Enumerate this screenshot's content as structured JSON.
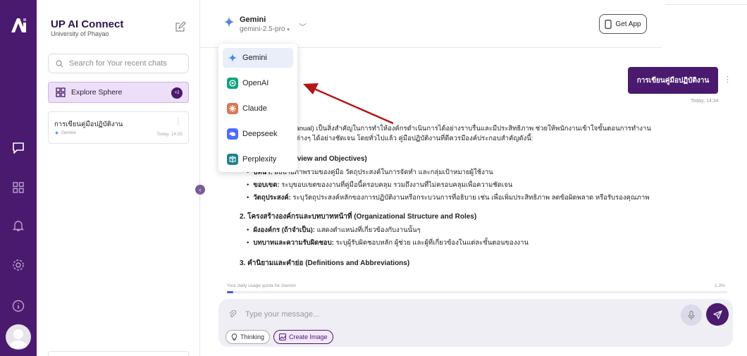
{
  "sidebar": {
    "brand_title": "UP AI Connect",
    "brand_subtitle": "University of Phayao",
    "search_placeholder": "Search for Your recent chats",
    "explore_label": "Explore Sphere",
    "explore_badge": "+2",
    "chats": [
      {
        "title": "การเขียนคู่มือปฏิบัติงาน",
        "model": "Gemini",
        "time": "Today, 14:35"
      }
    ]
  },
  "rail": {
    "icons": [
      "chat-icon",
      "apps-icon",
      "bell-icon",
      "settings-icon",
      "info-icon"
    ]
  },
  "header": {
    "model_name": "Gemini",
    "model_version": "gemini-2.5-pro",
    "get_app_label": "Get App"
  },
  "model_menu": {
    "selected": "Gemini",
    "items": [
      {
        "label": "Gemini",
        "color": "#4285f4"
      },
      {
        "label": "OpenAI",
        "color": "#10a37f"
      },
      {
        "label": "Claude",
        "color": "#d97757"
      },
      {
        "label": "Deepseek",
        "color": "#4d6bfe"
      },
      {
        "label": "Perplexity",
        "color": "#20808d"
      }
    ]
  },
  "conversation": {
    "user_message": "การเขียนคู่มือปฏิบัติงาน",
    "user_time": "Today, 14:34",
    "reply_intro_1": "ปฏิบัติงาน (Work Manual) เป็นสิ่งสำคัญในการทำให้องค์กรดำเนินการได้อย่างราบรื่นและมีประสิทธิภาพ ช่วยให้พนักงานเข้าใจขั้นตอนการทำงาน",
    "reply_intro_2": "ตามเกณฑ์ที่กำหนดต่างๆ ได้อย่างชัดเจน โดยทั่วไปแล้ว คู่มือปฏิบัติงานที่ดีควรมีองค์ประกอบสำคัญดังนี้:",
    "section1_title": "วัตถุประสงค์ (Overview and Objectives)",
    "section1_items": [
      {
        "term": "บทนำ:",
        "text": "อธิบายภาพรวมของคู่มือ วัตถุประสงค์ในการจัดทำ และกลุ่มเป้าหมายผู้ใช้งาน"
      },
      {
        "term": "ขอบเขต:",
        "text": "ระบุขอบเขตของงานที่คู่มือนี้ครอบคลุม รวมถึงงานที่ไม่ครอบคลุมเพื่อความชัดเจน"
      },
      {
        "term": "วัตถุประสงค์:",
        "text": "ระบุวัตถุประสงค์หลักของการปฏิบัติงานหรือกระบวนการที่อธิบาย เช่น เพื่อเพิ่มประสิทธิภาพ ลดข้อผิดพลาด หรือรับรองคุณภาพ"
      }
    ],
    "section2_title": "2. โครงสร้างองค์กรและบทบาทหน้าที่ (Organizational Structure and Roles)",
    "section2_items": [
      {
        "term": "ผังองค์กร (ถ้าจำเป็น):",
        "text": "แสดงตำแหน่งที่เกี่ยวข้องกับงานนั้นๆ"
      },
      {
        "term": "บทบาทและความรับผิดชอบ:",
        "text": "ระบุผู้รับผิดชอบหลัก ผู้ช่วย และผู้ที่เกี่ยวข้องในแต่ละขั้นตอนของงาน"
      }
    ],
    "section3_title": "3. คำนิยามและคำย่อ (Definitions and Abbreviations)"
  },
  "quota": {
    "label": "Your daily usage quota for Gemini",
    "percent_text": "1.3%",
    "fraction": 0.013
  },
  "composer": {
    "placeholder": "Type your message...",
    "thinking_label": "Thinking",
    "create_image_label": "Create Image"
  },
  "colors": {
    "brand": "#4a1a6e",
    "annotation_arrow": "#b01818"
  }
}
